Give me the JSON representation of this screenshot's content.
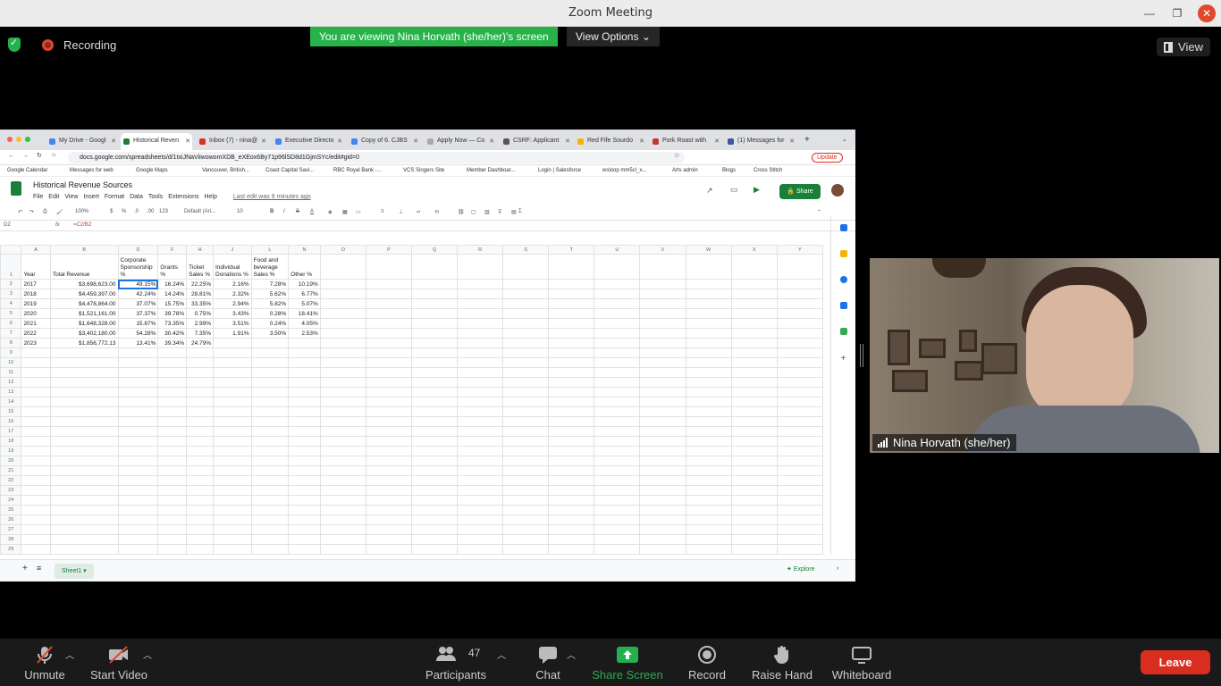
{
  "window": {
    "title": "Zoom Meeting"
  },
  "meeting": {
    "recording_label": "Recording",
    "viewing_banner": "You are viewing Nina Horvath (she/her)'s screen",
    "view_options": "View Options",
    "view_label": "View"
  },
  "browser": {
    "tabs": [
      {
        "label": "My Drive - Googl",
        "color": "#4285f4"
      },
      {
        "label": "Historical Reven",
        "color": "#188038"
      },
      {
        "label": "Inbox (7) - nina@",
        "color": "#d93025"
      },
      {
        "label": "Executive Directo",
        "color": "#4285f4"
      },
      {
        "label": "Copy of 6. CJBS",
        "color": "#4285f4"
      },
      {
        "label": "Apply Now — Co",
        "color": "#aaaaaa"
      },
      {
        "label": "CSRF: Applicant",
        "color": "#555555"
      },
      {
        "label": "Red Fife Sourdo",
        "color": "#f4b400"
      },
      {
        "label": "Pork Roast with",
        "color": "#c0392b"
      },
      {
        "label": "(1) Messages for",
        "color": "#3b5998"
      }
    ],
    "url": "docs.google.com/spreadsheets/d/1txiJNaViiwowomXDB_eXEox6By71p96lSD8d1GjmSYc/edit#gid=0",
    "update_label": "Update",
    "bookmarks": [
      "Google Calendar",
      "Messages for web",
      "Google Maps",
      "Vancouver, British...",
      "Coast Capital Savi...",
      "RBC Royal Bank -...",
      "VCS Singers Site",
      "Member Dashboar...",
      "Login | Salesforce",
      "wsloop mm5cl_x...",
      "Arts admin",
      "Blogs",
      "Cross Stitch"
    ]
  },
  "sheets": {
    "doc_title": "Historical Revenue Sources",
    "menus": [
      "File",
      "Edit",
      "View",
      "Insert",
      "Format",
      "Data",
      "Tools",
      "Extensions",
      "Help"
    ],
    "last_edit": "Last edit was 9 minutes ago",
    "share_label": "Share",
    "toolbar": {
      "zoom": "100%",
      "currency": "$",
      "percent": "%",
      "dec_less": ".0",
      "dec_more": ".00",
      "format": "123",
      "font": "Default (Ari...",
      "size": "10"
    },
    "name_box": "D2",
    "formula": "=C2/B2",
    "column_letters": [
      "A",
      "B",
      "D",
      "F",
      "H",
      "J",
      "L",
      "N",
      "O",
      "P",
      "Q",
      "R",
      "S",
      "T",
      "U",
      "V",
      "W",
      "X",
      "Y"
    ],
    "headers": [
      "Year",
      "Total Revenue",
      "Corporate Sponsorship %",
      "Grants %",
      "Ticket Sales %",
      "Individual Donations %",
      "Food and beverage Sales %",
      "Other %"
    ],
    "rows": [
      [
        "2017",
        "$3,698,623.00",
        "49.15%",
        "16.24%",
        "22.25%",
        "2.16%",
        "7.28%",
        "10.19%"
      ],
      [
        "2018",
        "$4,459,397.00",
        "42.24%",
        "14.24%",
        "28.81%",
        "2.32%",
        "5.62%",
        "6.77%"
      ],
      [
        "2019",
        "$4,478,864.00",
        "37.07%",
        "15.75%",
        "33.35%",
        "2.94%",
        "5.82%",
        "5.07%"
      ],
      [
        "2020",
        "$1,521,161.00",
        "37.37%",
        "39.78%",
        "0.75%",
        "3.43%",
        "0.28%",
        "18.41%"
      ],
      [
        "2021",
        "$1,648,328.00",
        "15.87%",
        "73.35%",
        "2.99%",
        "3.51%",
        "0.24%",
        "4.05%"
      ],
      [
        "2022",
        "$3,402,180.00",
        "54.28%",
        "30.42%",
        "7.35%",
        "1.91%",
        "3.50%",
        "2.53%"
      ],
      [
        "2023",
        "$1,856,772.13",
        "13.41%",
        "39.34%",
        "24.79%",
        "",
        "",
        ""
      ]
    ],
    "sheet_tab": "Sheet1",
    "explore_label": "Explore"
  },
  "participant": {
    "name": "Nina Horvath (she/her)"
  },
  "controls": {
    "unmute": "Unmute",
    "start_video": "Start Video",
    "participants": "Participants",
    "participant_count": "47",
    "chat": "Chat",
    "share_screen": "Share Screen",
    "record": "Record",
    "raise_hand": "Raise Hand",
    "whiteboard": "Whiteboard",
    "leave": "Leave"
  }
}
